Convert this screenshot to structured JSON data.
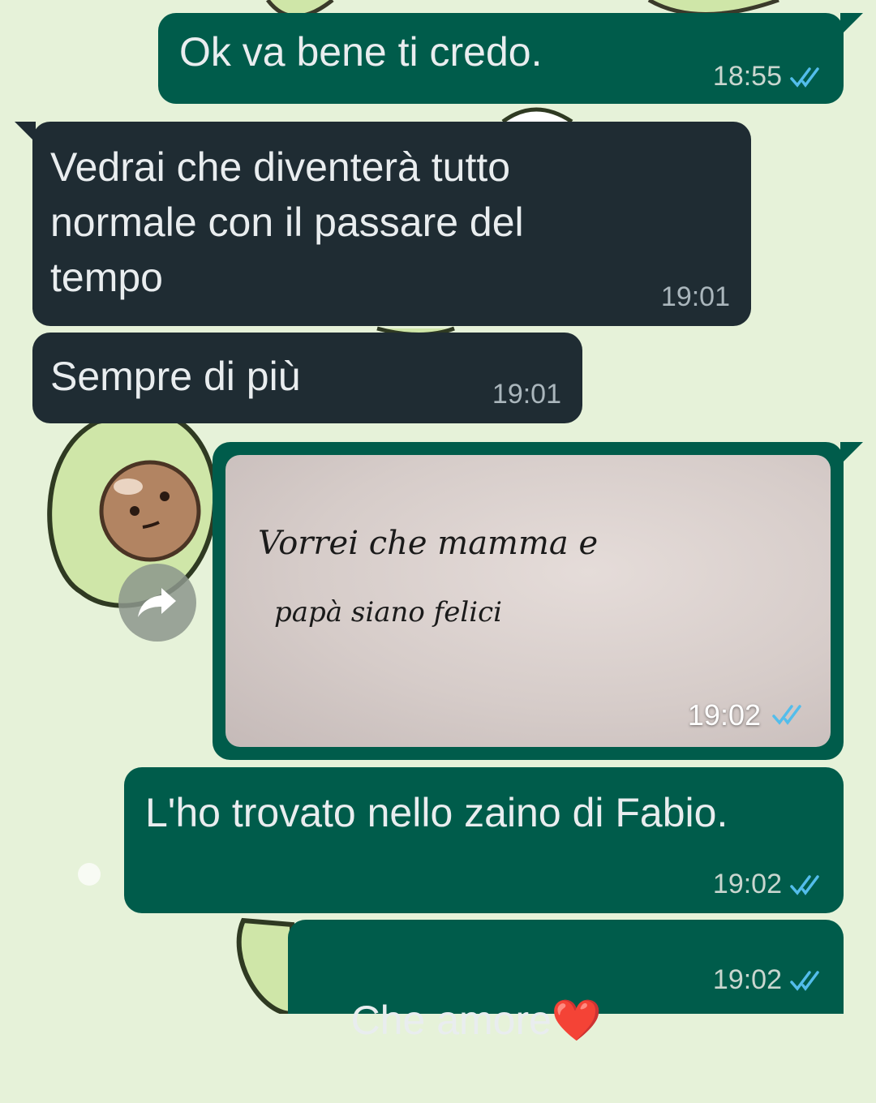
{
  "messages": [
    {
      "text": "Ok va bene ti credo.",
      "time": "18:55"
    },
    {
      "text": "Vedrai che diventerà tutto\nnormale con il passare del\ntempo",
      "time": "19:01"
    },
    {
      "text": "Sempre di più",
      "time": "19:01"
    },
    {
      "handwriting": [
        "Vorrei che mamma e",
        "papà siano felici"
      ],
      "time": "19:02"
    },
    {
      "text": "L'ho trovato nello zaino di Fabio.",
      "time": "19:02"
    },
    {
      "text": "Che amore",
      "emoji": "❤️",
      "time": "19:02"
    }
  ],
  "icons": {
    "read_receipt": "double-check-icon",
    "forward": "forward-arrow-icon",
    "wallpaper": "avocado-icon"
  },
  "colors": {
    "outgoing_bubble": "#005c4b",
    "incoming_bubble": "#1f2c33",
    "read_tick": "#53bdeb",
    "wallpaper": "#e6f2d9"
  }
}
